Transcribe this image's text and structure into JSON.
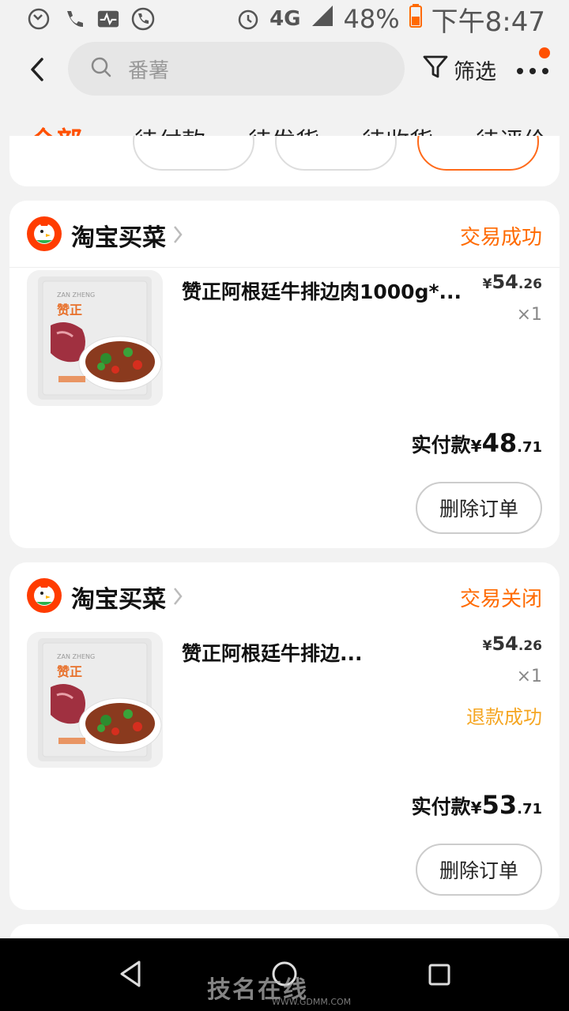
{
  "status_bar": {
    "network": "4G",
    "battery": "48%",
    "time": "下午8:47"
  },
  "header": {
    "search_placeholder": "番薯",
    "filter_label": "筛选"
  },
  "tabs": [
    "全部",
    "待付款",
    "待发货",
    "待收货",
    "待评价"
  ],
  "orders": [
    {
      "shop": "淘宝买菜",
      "status": "交易成功",
      "product_title": "赞正阿根廷牛排边肉1000g*...",
      "price_yen": "¥",
      "price_int": "54",
      "price_dec": ".26",
      "quantity": "×1",
      "refund_status": "",
      "paid_label": "实付款",
      "paid_yen": "¥",
      "paid_int": "48",
      "paid_dec": ".71",
      "action": "删除订单"
    },
    {
      "shop": "淘宝买菜",
      "status": "交易关闭",
      "product_title": "赞正阿根廷牛排边...",
      "price_yen": "¥",
      "price_int": "54",
      "price_dec": ".26",
      "quantity": "×1",
      "refund_status": "退款成功",
      "paid_label": "实付款",
      "paid_yen": "¥",
      "paid_int": "53",
      "paid_dec": ".71",
      "action": "删除订单"
    }
  ],
  "product_image_text": {
    "brand_en": "ZAN ZHENG",
    "brand_cn": "赞正"
  },
  "watermark": {
    "text": "技名在线",
    "url": "WWW.GDMM.COM"
  },
  "colors": {
    "accent": "#ff5000",
    "status": "#ff6a00",
    "refund": "#f5a623"
  }
}
